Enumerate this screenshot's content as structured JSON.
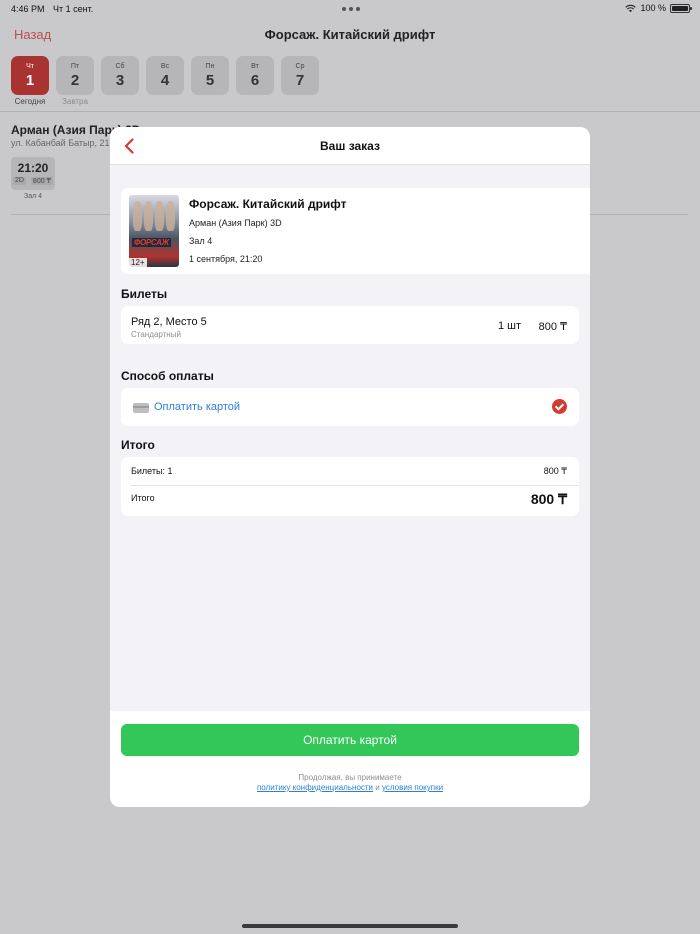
{
  "statusbar": {
    "time": "4:46 PM",
    "date": "Чт 1 сент.",
    "battery": "100 %"
  },
  "background": {
    "back_label": "Назад",
    "title": "Форсаж. Китайский дрифт",
    "days": [
      {
        "weekday": "Чт",
        "num": "1",
        "under": "Сегодня"
      },
      {
        "weekday": "Пт",
        "num": "2",
        "under": "Завтра"
      },
      {
        "weekday": "Сб",
        "num": "3"
      },
      {
        "weekday": "Вс",
        "num": "4"
      },
      {
        "weekday": "Пн",
        "num": "5"
      },
      {
        "weekday": "Вт",
        "num": "6"
      },
      {
        "weekday": "Ср",
        "num": "7"
      }
    ],
    "cinema_name": "Арман (Азия Парк) 3D",
    "cinema_address": "ул. Кабанбай Батыр, 21",
    "showtime": {
      "time": "21:20",
      "format": "2D",
      "price": "800 ₸",
      "hall": "Зал 4"
    }
  },
  "modal": {
    "title": "Ваш заказ",
    "film": {
      "poster_title": "ФОРСАЖ",
      "age": "12+",
      "title": "Форсаж. Китайский дрифт",
      "cinema": "Арман (Азия Парк) 3D",
      "hall": "Зал 4",
      "datetime": "1 сентября, 21:20"
    },
    "tickets": {
      "section_title": "Билеты",
      "seat": "Ряд 2, Место 5",
      "type": "Стандартный",
      "qty": "1 шт",
      "price": "800 ₸"
    },
    "payment": {
      "section_title": "Способ оплаты",
      "method": "Оплатить картой"
    },
    "total": {
      "section_title": "Итого",
      "tickets_label": "Билеты: 1",
      "tickets_value": "800 ₸",
      "total_label": "Итого",
      "total_value": "800 ₸"
    },
    "pay_button": "Оплатить картой",
    "legal": {
      "line1": "Продолжая, вы принимаете",
      "privacy": "политику конфиденциальности",
      "and": "и",
      "terms": "условия покупки"
    }
  },
  "colors": {
    "accent_red": "#d23b2f",
    "pay_green": "#33c659",
    "link_blue": "#2f7ed8"
  }
}
